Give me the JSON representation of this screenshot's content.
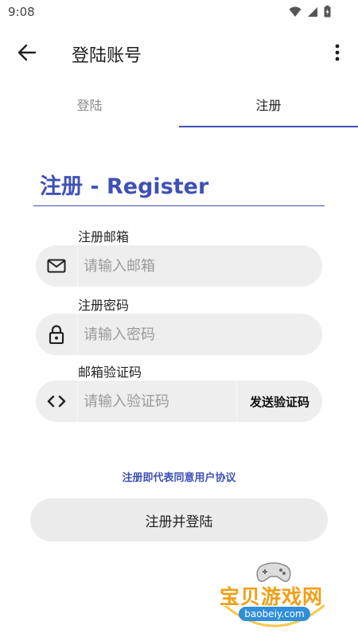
{
  "status_bar": {
    "time": "9:08",
    "icons": [
      "wifi-icon",
      "cellular-signal-icon",
      "battery-icon"
    ]
  },
  "app_bar": {
    "title": "登陆账号",
    "back_icon": "arrow-back-icon",
    "more_icon": "more-vert-icon"
  },
  "tabs": [
    {
      "label": "登陆",
      "selected": false
    },
    {
      "label": "注册",
      "selected": true
    }
  ],
  "form": {
    "title": "注册 - Register",
    "email": {
      "label": "注册邮箱",
      "placeholder": "请输入邮箱",
      "value": "",
      "icon": "mail-icon"
    },
    "password": {
      "label": "注册密码",
      "placeholder": "请输入密码",
      "value": "",
      "icon": "lock-icon"
    },
    "code": {
      "label": "邮箱验证码",
      "placeholder": "请输入验证码",
      "value": "",
      "icon": "code-brackets-icon",
      "send_label": "发送验证码"
    },
    "agreement_link": "注册即代表同意用户协议",
    "submit_label": "注册并登陆"
  },
  "watermark": {
    "main_text": "宝贝游戏网",
    "url_text": "baobeiy.com"
  },
  "colors": {
    "accent": "#3f51b5",
    "field_background": "#eeeeee",
    "button_background": "#ececec",
    "watermark_orange": "#f0a018",
    "watermark_blue": "#2f8fd8"
  }
}
